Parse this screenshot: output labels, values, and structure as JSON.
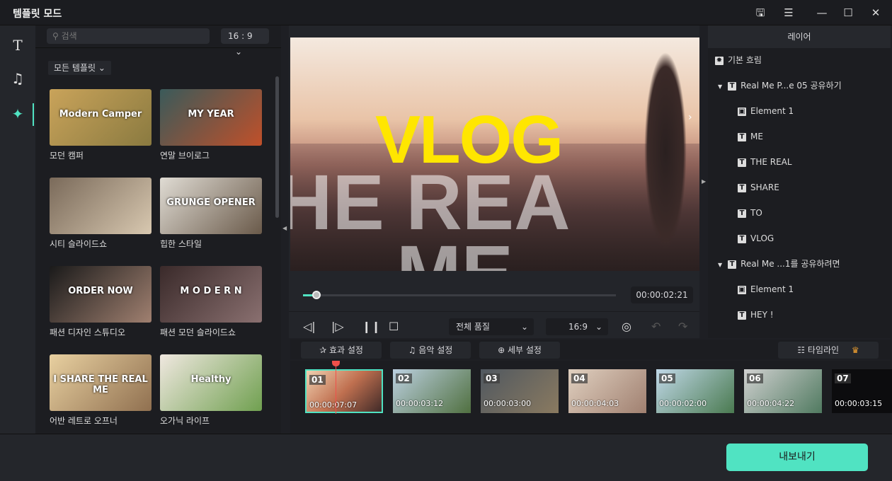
{
  "window": {
    "title": "템플릿 모드",
    "icons": [
      "save-icon",
      "list-icon",
      "minimize-icon",
      "maximize-icon",
      "close-icon"
    ]
  },
  "sidebar": {
    "icons": [
      "text-icon",
      "music-icon",
      "template-icon"
    ]
  },
  "templates": {
    "search_placeholder": "검색",
    "ratio": "16 : 9",
    "filter": "모든 템플릿",
    "items": [
      {
        "label": "모던 캠퍼",
        "thumb_text": "Modern Camper"
      },
      {
        "label": "연말 브이로그",
        "thumb_text": "MY YEAR"
      },
      {
        "label": "시티 슬라이드쇼",
        "thumb_text": ""
      },
      {
        "label": "힙한 스타일",
        "thumb_text": "GRUNGE OPENER"
      },
      {
        "label": "패션 디자인 스튜디오",
        "thumb_text": "ORDER NOW"
      },
      {
        "label": "패션 모던 슬라이드쇼",
        "thumb_text": "M O D E R N"
      },
      {
        "label": "어반 레트로 오프너",
        "thumb_text": "I SHARE THE REAL ME"
      },
      {
        "label": "오가닉 라이프",
        "thumb_text": "Healthy"
      }
    ]
  },
  "preview": {
    "title_text": "VLOG",
    "ghost_line1": "HE REA",
    "ghost_line2": "ME",
    "time": "00:00:02:21",
    "progress": 0.03,
    "quality": "전체 품질",
    "aspect": "16:9"
  },
  "layers": {
    "header": "레이어",
    "items": [
      {
        "label": "기본 흐림",
        "level": 0,
        "type": "effect"
      },
      {
        "label": "Real Me P...e 05 공유하기",
        "level": 1,
        "type": "text",
        "expanded": true
      },
      {
        "label": "Element 1",
        "level": 2,
        "type": "element"
      },
      {
        "label": "ME",
        "level": 2,
        "type": "text"
      },
      {
        "label": "THE REAL",
        "level": 2,
        "type": "text"
      },
      {
        "label": "SHARE",
        "level": 2,
        "type": "text"
      },
      {
        "label": "TO",
        "level": 2,
        "type": "text"
      },
      {
        "label": "VLOG",
        "level": 2,
        "type": "text"
      },
      {
        "label": "Real Me ...1를 공유하려면",
        "level": 1,
        "type": "text",
        "expanded": true
      },
      {
        "label": "Element 1",
        "level": 2,
        "type": "element"
      },
      {
        "label": "HEY !",
        "level": 2,
        "type": "text"
      }
    ]
  },
  "toolbar": {
    "effects": "효과 설정",
    "music": "음악 설정",
    "details": "세부 설정",
    "timeline": "타임라인"
  },
  "clips": [
    {
      "num": "01",
      "time": "00:00:07:07"
    },
    {
      "num": "02",
      "time": "00:00:03:12"
    },
    {
      "num": "03",
      "time": "00:00:03:00"
    },
    {
      "num": "04",
      "time": "00:00:04:03"
    },
    {
      "num": "05",
      "time": "00:00:02:00"
    },
    {
      "num": "06",
      "time": "00:00:04:22"
    },
    {
      "num": "07",
      "time": "00:00:03:15"
    }
  ],
  "export": {
    "label": "내보내기"
  },
  "colors": {
    "accent": "#50e3c2",
    "vlog_yellow": "#ffe600",
    "playhead": "#f0504a"
  }
}
